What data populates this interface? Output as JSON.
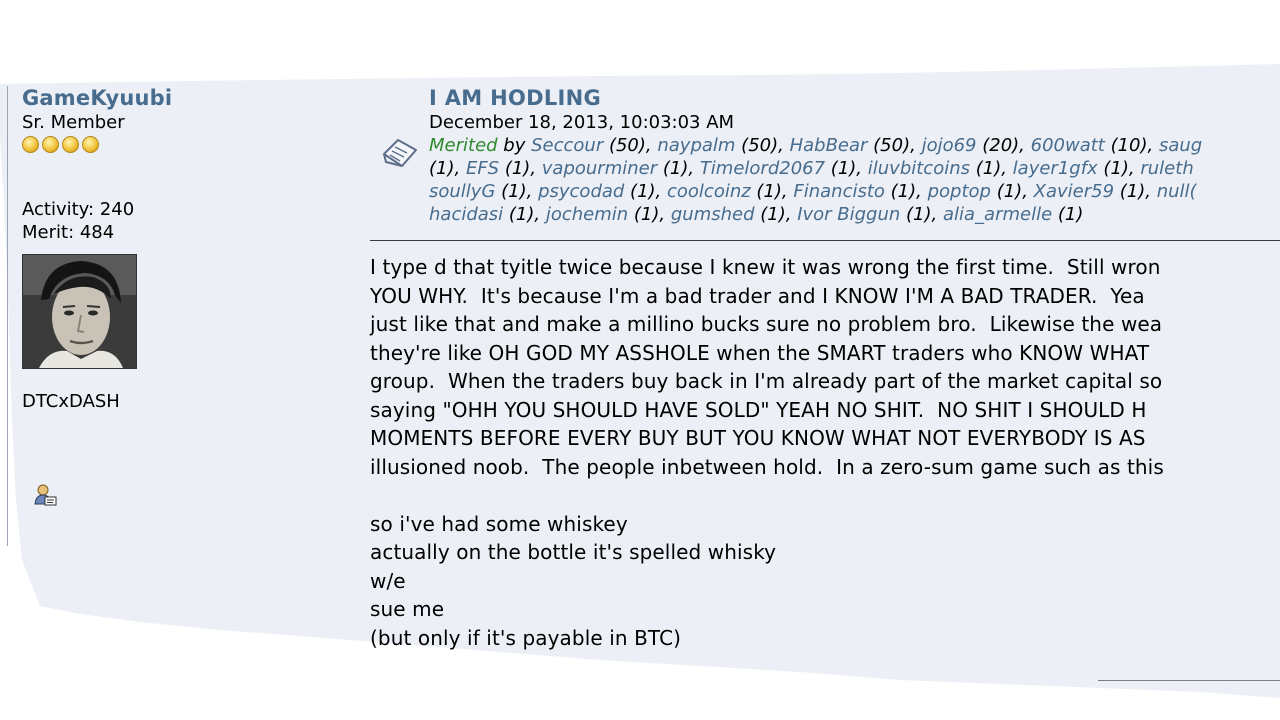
{
  "poster": {
    "name": "GameKyuubi",
    "rank": "Sr. Member",
    "star_count": 4,
    "activity": "Activity: 240",
    "merit": "Merit: 484",
    "signature": "DTCxDASH"
  },
  "post": {
    "title": "I AM HODLING",
    "date": "December 18, 2013, 10:03:03 AM",
    "merited_label": "Merited",
    "merited_by": "by",
    "merit_rows": [
      [
        {
          "user": "Seccour",
          "points": "(50)"
        },
        {
          "user": "naypalm",
          "points": "(50)"
        },
        {
          "user": "HabBear",
          "points": "(50)"
        },
        {
          "user": "jojo69",
          "points": "(20)"
        },
        {
          "user": "600watt",
          "points": "(10)"
        },
        {
          "user": "saug",
          "points": ""
        }
      ],
      [
        {
          "user": "",
          "points": "(1)"
        },
        {
          "user": "EFS",
          "points": "(1)"
        },
        {
          "user": "vapourminer",
          "points": "(1)"
        },
        {
          "user": "Timelord2067",
          "points": "(1)"
        },
        {
          "user": "iluvbitcoins",
          "points": "(1)"
        },
        {
          "user": "layer1gfx",
          "points": "(1)"
        },
        {
          "user": "ruleth",
          "points": ""
        }
      ],
      [
        {
          "user": "soullyG",
          "points": "(1)"
        },
        {
          "user": "psycodad",
          "points": "(1)"
        },
        {
          "user": "coolcoinz",
          "points": "(1)"
        },
        {
          "user": "Financisto",
          "points": "(1)"
        },
        {
          "user": "poptop",
          "points": "(1)"
        },
        {
          "user": "Xavier59",
          "points": "(1)"
        },
        {
          "user": "null(",
          "points": ""
        }
      ],
      [
        {
          "user": "hacidasi",
          "points": "(1)"
        },
        {
          "user": "jochemin",
          "points": "(1)"
        },
        {
          "user": "gumshed",
          "points": "(1)"
        },
        {
          "user": "Ivor Biggun",
          "points": "(1)"
        },
        {
          "user": "alia_armelle",
          "points": "(1)"
        }
      ]
    ],
    "body_lines": [
      "I type d that tyitle twice because I knew it was wrong the first time.  Still wron",
      "YOU WHY.  It's because I'm a bad trader and I KNOW I'M A BAD TRADER.  Yea",
      "just like that and make a millino bucks sure no problem bro.  Likewise the wea",
      "they're like OH GOD MY ASSHOLE when the SMART traders who KNOW WHAT",
      "group.  When the traders buy back in I'm already part of the market capital so",
      "saying \"OHH YOU SHOULD HAVE SOLD\" YEAH NO SHIT.  NO SHIT I SHOULD H",
      "MOMENTS BEFORE EVERY BUY BUT YOU KNOW WHAT NOT EVERYBODY IS AS",
      "illusioned noob.  The people inbetween hold.  In a zero-sum game such as this",
      "",
      "so i've had some whiskey",
      "actually on the bottle it's spelled whisky",
      "w/e",
      "sue me",
      "(but only if it's payable in BTC)"
    ]
  },
  "icons": {
    "subject": "post-subject-icon",
    "profile": "user-profile-icon",
    "avatar": "user-avatar"
  },
  "colors": {
    "link": "#476c8e",
    "merited": "#2e8b2e",
    "panel": "#eceff5"
  }
}
